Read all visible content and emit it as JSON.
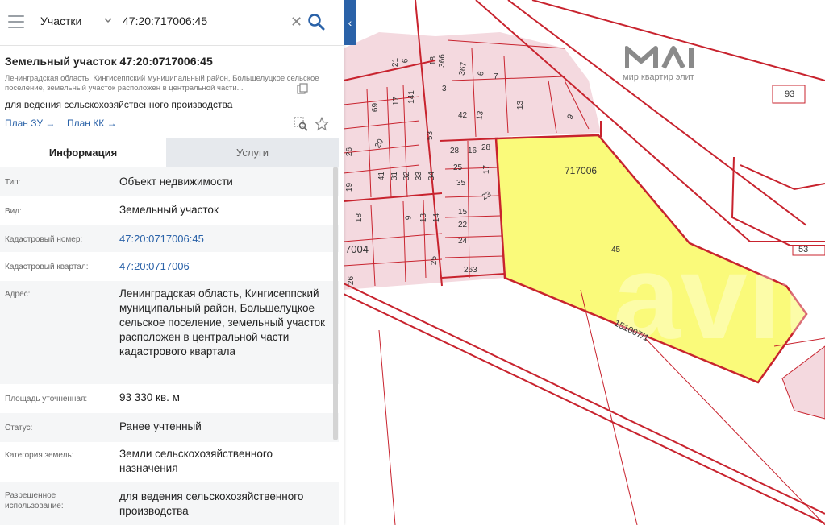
{
  "search": {
    "category": "Участки",
    "query": "47:20:717006:45"
  },
  "object": {
    "title": "Земельный участок 47:20:0717006:45",
    "address_short": "Ленинградская область, Кингисеппский муниципальный район, Большелуцкое сельское поселение, земельный участок расположен в центральной части...",
    "usage": "для ведения сельскохозяйственного производства",
    "plan_zu": "План ЗУ →",
    "plan_kk": "План КК →"
  },
  "tabs": {
    "info": "Информация",
    "services": "Услуги"
  },
  "info": {
    "type_label": "Тип:",
    "type_value": "Объект недвижимости",
    "kind_label": "Вид:",
    "kind_value": "Земельный участок",
    "cadnum_label": "Кадастровый номер:",
    "cadnum_value": "47:20:0717006:45",
    "quarter_label": "Кадастровый квартал:",
    "quarter_value": "47:20:0717006",
    "address_label": "Адрес:",
    "address_value": "Ленинградская область, Кингисеппский муниципальный район, Большелуцкое сельское поселение, земельный участок расположен в центральной части кадастрового квартала",
    "area_label": "Площадь уточненная:",
    "area_value": "93 330 кв. м",
    "status_label": "Статус:",
    "status_value": "Ранее учтенный",
    "category_label": "Категория земель:",
    "category_value": "Земли сельскохозяйственного назначения",
    "permitted_label": "Разрешенное использование:",
    "permitted_value": "для ведения сельскохозяйственного производства"
  },
  "map": {
    "parcel_quarter": "717006",
    "parcel_number": "45",
    "quarter_left": "7004",
    "road_label": "151007/1",
    "label_93": "93",
    "label_53": "53",
    "watermark": "мир квартир элит",
    "numbers": [
      "18",
      "366",
      "367",
      "6",
      "7",
      "21",
      "6",
      "3",
      "13",
      "141",
      "17",
      "69",
      "13",
      "42",
      "9",
      "53",
      "28",
      "16",
      "28",
      "20",
      "26",
      "25",
      "17",
      "41",
      "31",
      "32",
      "33",
      "34",
      "35",
      "18",
      "23",
      "9",
      "13",
      "14",
      "15",
      "22",
      "24",
      "25",
      "263",
      "26",
      "19",
      "62"
    ]
  },
  "colors": {
    "accent": "#2a62a8",
    "parcel_fill": "#fafa7a",
    "lot_fill": "#f5d8de",
    "boundary": "#c8232e"
  }
}
